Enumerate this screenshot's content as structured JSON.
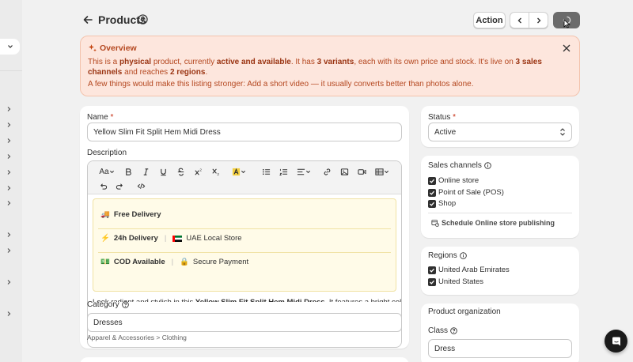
{
  "header": {
    "title": "Products",
    "action_label": "Action"
  },
  "banner": {
    "title": "Overview",
    "line1_a": "This is a ",
    "line1_physical": "physical",
    "line1_b": " product, currently ",
    "line1_status": "active and available",
    "line1_c": ". It has ",
    "line1_variants": "3 variants",
    "line1_d": ", each with its own price and stock. It's live on ",
    "line1_channels": "3 sales channels",
    "line1_e": " and reaches ",
    "line1_regions": "2 regions",
    "line1_f": ".",
    "line2": "A few things would make this listing stronger: Add a short video — it usually converts better than photos alone."
  },
  "form": {
    "name_label": "Name",
    "required_mark": "*",
    "name_value": "Yellow Slim Fit Split Hem Midi Dress",
    "description_label": "Description",
    "features": {
      "free_delivery": "Free Delivery",
      "fast_delivery": "24h Delivery",
      "store": "UAE Local Store",
      "cod": "COD Available",
      "payment": "Secure Payment"
    },
    "desc_peek_a": "Look radiant and stylish in this ",
    "desc_peek_b": "Yellow Slim Fit Split Hem Midi Dress",
    "desc_peek_c": ". It features a bright color",
    "category_label": "Category",
    "category_value": "Dresses",
    "category_path": "Apparel & Accessories > Clothing"
  },
  "toolbar": {
    "font_label": "Aa"
  },
  "status": {
    "label": "Status",
    "required_mark": "*",
    "value": "Active"
  },
  "sales_channels": {
    "title": "Sales channels",
    "items": [
      "Online store",
      "Point of Sale (POS)",
      "Shop"
    ],
    "schedule_label": "Schedule Online store publishing"
  },
  "regions": {
    "title": "Regions",
    "items": [
      "United Arab Emirates",
      "United States"
    ]
  },
  "organization": {
    "title": "Product organization",
    "class_label": "Class",
    "class_value": "Dress"
  },
  "colors": {
    "banner_bg": "#fde6dd",
    "banner_text": "#b4471f",
    "primary_button": "#6b6b6b"
  }
}
